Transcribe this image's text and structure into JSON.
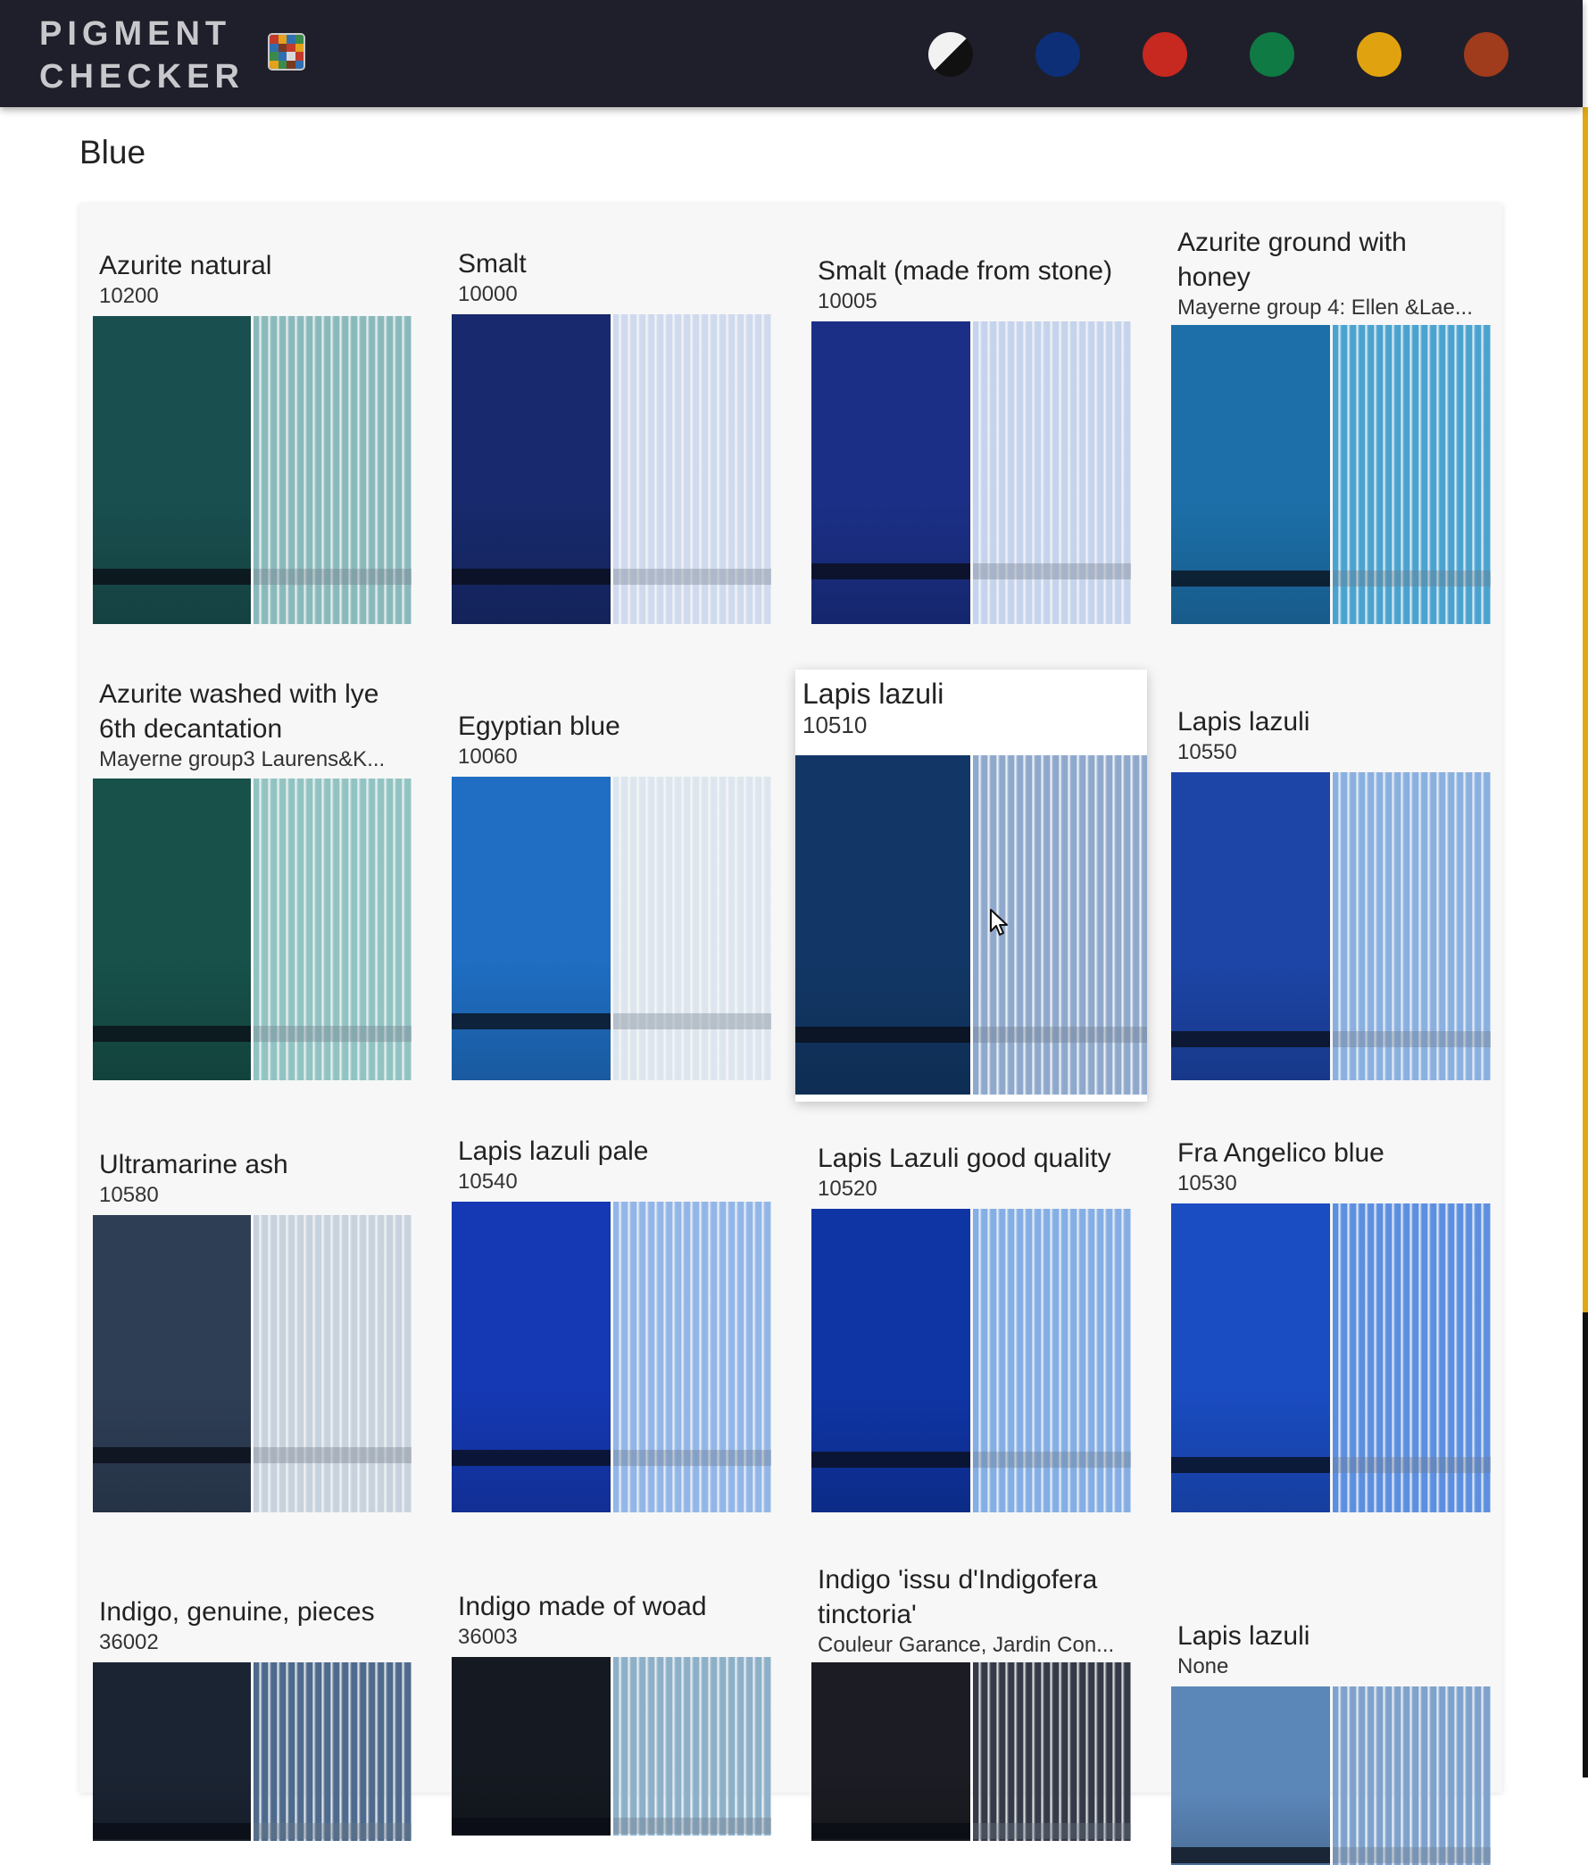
{
  "app": {
    "logo_line1": "PIGMENT",
    "logo_line2": "CHECKER"
  },
  "color_filters": [
    {
      "name": "black-white-filter",
      "color": "#111111"
    },
    {
      "name": "blue-filter",
      "color": "#0d2f78"
    },
    {
      "name": "red-filter",
      "color": "#c7281f"
    },
    {
      "name": "green-filter",
      "color": "#0f7a43"
    },
    {
      "name": "yellow-filter",
      "color": "#e0a20e"
    },
    {
      "name": "brown-filter",
      "color": "#a03b1c"
    }
  ],
  "section": {
    "title": "Blue"
  },
  "pigments": [
    {
      "name": "Azurite natural",
      "code": "10200",
      "dark": "#194f4f",
      "light": "#8ab9bb"
    },
    {
      "name": "Smalt",
      "code": "10000",
      "dark": "#182a6d",
      "light": "#cfdaee"
    },
    {
      "name": "Smalt (made from stone)",
      "code": "10005",
      "dark": "#1b2f86",
      "light": "#c6d3ec"
    },
    {
      "name": "Azurite ground with honey",
      "code": "Mayerne group 4: Ellen &Lae...",
      "dark": "#1c6fa8",
      "light": "#4aa3cf"
    },
    {
      "name": "Azurite washed with lye 6th decantation",
      "code": "Mayerne group3 Laurens&K...",
      "dark": "#17514a",
      "light": "#92c3c3"
    },
    {
      "name": "Egyptian blue",
      "code": "10060",
      "dark": "#1f6ec3",
      "light": "#dde6ee"
    },
    {
      "name": "Lapis lazuli",
      "code": "10510",
      "dark": "#123766",
      "light": "#8fa9cc"
    },
    {
      "name": "Lapis lazuli",
      "code": "10550",
      "dark": "#1d45a8",
      "light": "#8ab0e0"
    },
    {
      "name": "Ultramarine ash",
      "code": "10580",
      "dark": "#2e3e55",
      "light": "#c8d2dd"
    },
    {
      "name": "Lapis lazuli pale",
      "code": "10540",
      "dark": "#1539b4",
      "light": "#93b6e8"
    },
    {
      "name": "Lapis Lazuli good quality",
      "code": "10520",
      "dark": "#0f35a5",
      "light": "#84aee4"
    },
    {
      "name": "Fra Angelico blue",
      "code": "10530",
      "dark": "#1a4cc2",
      "light": "#5d8fe0"
    },
    {
      "name": "Indigo, genuine, pieces",
      "code": "36002",
      "dark": "#1b2433",
      "light": "#4e6a8c"
    },
    {
      "name": "Indigo made of woad",
      "code": "36003",
      "dark": "#151a22",
      "light": "#8db0c8"
    },
    {
      "name": "Indigo 'issu d'Indigofera tinctoria'",
      "code": "Couleur Garance, Jardin Con...",
      "dark": "#1c1c24",
      "light": "#353a48"
    },
    {
      "name": "Lapis lazuli",
      "code": "None",
      "dark": "#5b86b8",
      "light": "#7ea2cc"
    }
  ]
}
